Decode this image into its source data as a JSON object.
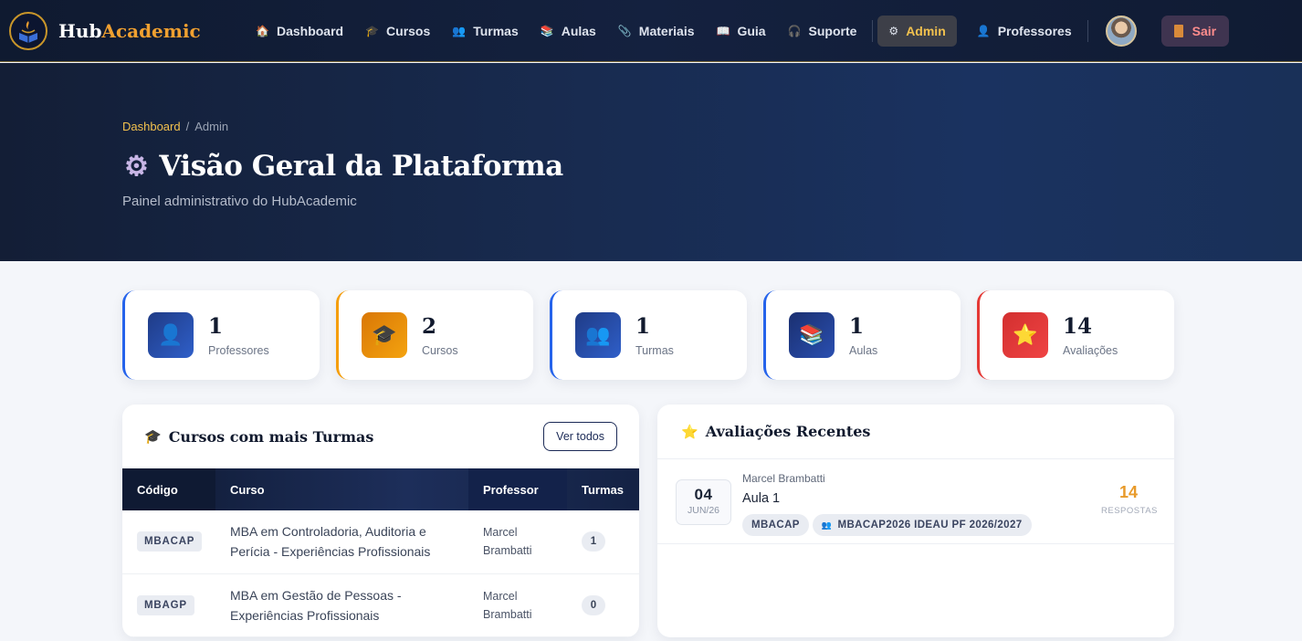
{
  "brand": {
    "name_part1": "Hub",
    "name_part2": "Academic"
  },
  "nav": {
    "items": [
      {
        "label": "Dashboard",
        "icon": "house-icon",
        "glyph": "🏠"
      },
      {
        "label": "Cursos",
        "icon": "mortarboard-icon",
        "glyph": "🎓"
      },
      {
        "label": "Turmas",
        "icon": "users-icon",
        "glyph": "👥"
      },
      {
        "label": "Aulas",
        "icon": "books-icon",
        "glyph": "📚"
      },
      {
        "label": "Materiais",
        "icon": "paperclip-icon",
        "glyph": "📎"
      },
      {
        "label": "Guia",
        "icon": "book-icon",
        "glyph": "📖"
      },
      {
        "label": "Suporte",
        "icon": "headset-icon",
        "glyph": "🎧"
      }
    ],
    "admin_label": "Admin",
    "admin_glyph": "⚙",
    "professores_label": "Professores",
    "professores_glyph": "👤",
    "logout_label": "Sair"
  },
  "hero": {
    "breadcrumb_link": "Dashboard",
    "breadcrumb_separator": "/",
    "breadcrumb_current": "Admin",
    "title": "Visão Geral da Plataforma",
    "title_icon": "⚙",
    "subtitle": "Painel administrativo do HubAcademic"
  },
  "stats": [
    {
      "value": "1",
      "label": "Professores",
      "icon": "user-icon",
      "glyph": "👤",
      "accent": "#2563eb"
    },
    {
      "value": "2",
      "label": "Cursos",
      "icon": "graduation-cap-icon",
      "glyph": "🎓",
      "accent": "#f59e0b"
    },
    {
      "value": "1",
      "label": "Turmas",
      "icon": "users-icon",
      "glyph": "👥",
      "accent": "#2563eb"
    },
    {
      "value": "1",
      "label": "Aulas",
      "icon": "books-icon",
      "glyph": "📚",
      "accent": "#2563eb"
    },
    {
      "value": "14",
      "label": "Avaliações",
      "icon": "star-icon",
      "glyph": "⭐",
      "accent": "#e53935"
    }
  ],
  "courses_panel": {
    "title": "Cursos com mais Turmas",
    "title_glyph": "🎓",
    "button": "Ver todos",
    "columns": [
      "Código",
      "Curso",
      "Professor",
      "Turmas"
    ],
    "rows": [
      {
        "code": "MBACAP",
        "course_line1": "MBA em Controladoria, Auditoria e",
        "course_line2": "Perícia - Experiências Profissionais",
        "prof_line1": "Marcel",
        "prof_line2": "Brambatti",
        "turmas": "1"
      },
      {
        "code": "MBAGP",
        "course_line1": "MBA em Gestão de Pessoas -",
        "course_line2": "Experiências Profissionais",
        "prof_line1": "Marcel",
        "prof_line2": "Brambatti",
        "turmas": "0"
      }
    ]
  },
  "reviews_panel": {
    "title": "Avaliações Recentes",
    "title_glyph": "⭐",
    "items": [
      {
        "day": "04",
        "month": "JUN/26",
        "author": "Marcel Brambatti",
        "title": "Aula 1",
        "tag_course": "MBACAP",
        "tag_class": "MBACAP2026 IDEAU PF 2026/2027",
        "count": "14",
        "count_label": "RESPOSTAS"
      }
    ]
  },
  "colors": {
    "accent_gold": "#f2c14e",
    "brand_orange": "#f0a030",
    "nav_bg": "#0f1a30",
    "hero_bg": "#1a3260",
    "logout_text": "#ff8d8d"
  }
}
